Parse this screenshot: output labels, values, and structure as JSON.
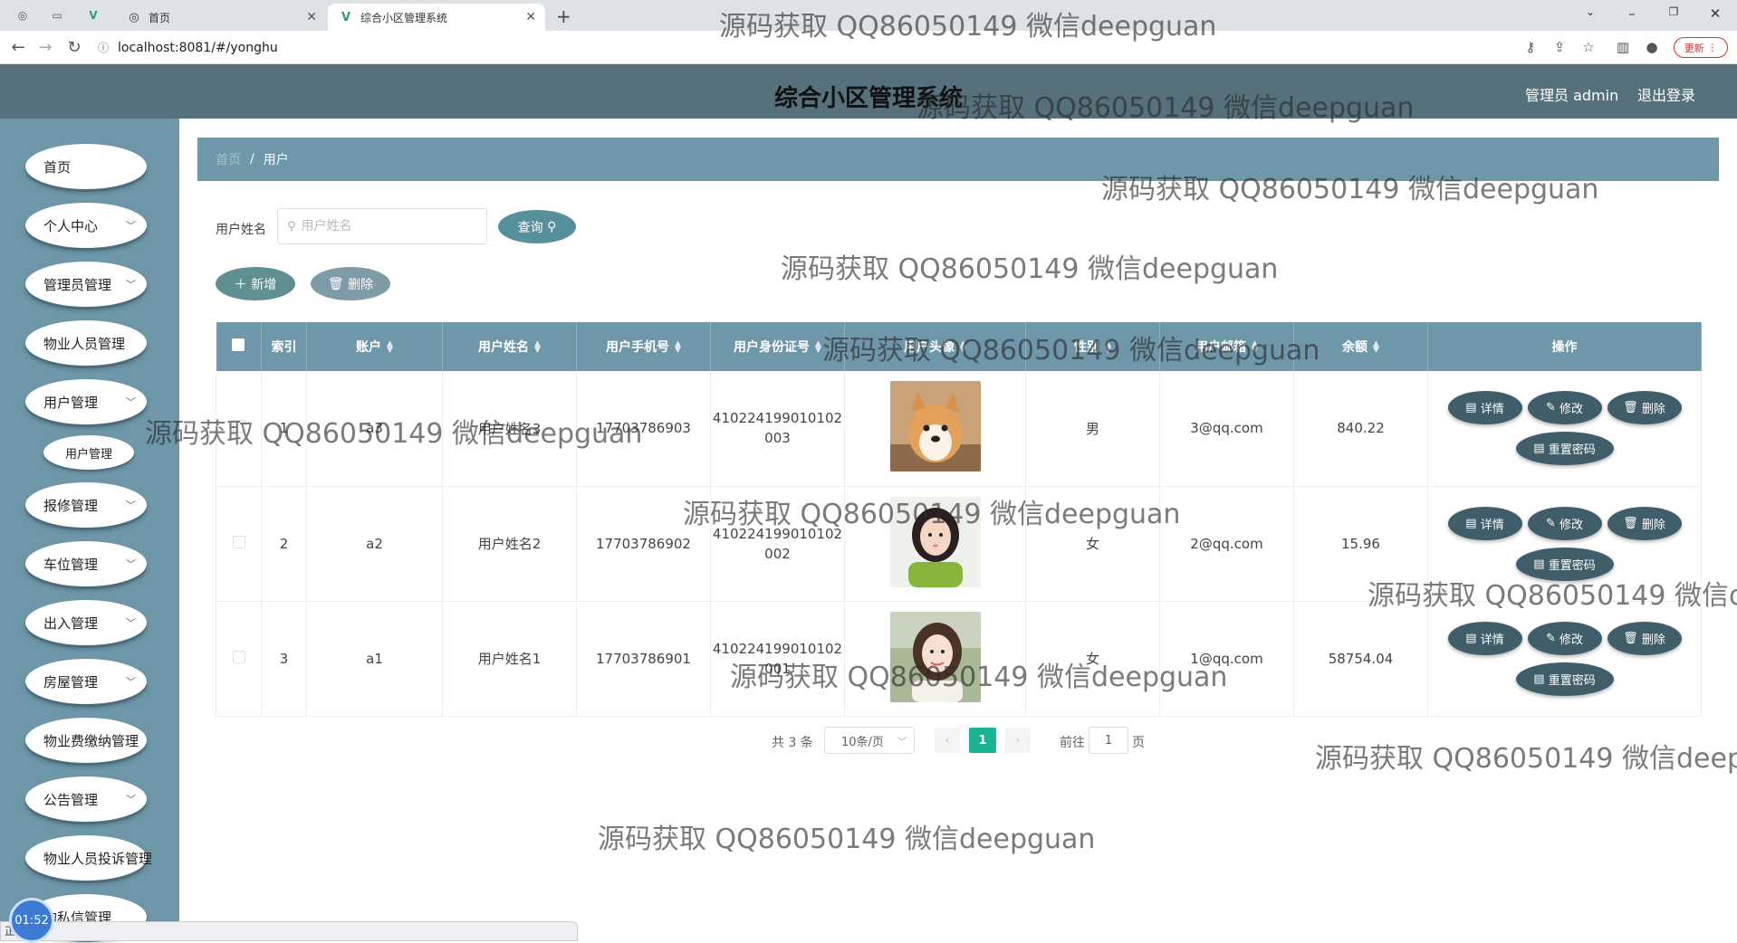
{
  "browser": {
    "tabs": [
      {
        "label": "首页",
        "icon": "globe-icon"
      },
      {
        "label": "综合小区管理系统",
        "icon": "vue-icon"
      }
    ],
    "url": "localhost:8081/#/yonghu",
    "update_label": "更新"
  },
  "header": {
    "title": "综合小区管理系统",
    "admin_label": "管理员 admin",
    "logout_label": "退出登录"
  },
  "sidebar": {
    "items": [
      {
        "label": "首页",
        "expandable": false
      },
      {
        "label": "个人中心",
        "expandable": true
      },
      {
        "label": "管理员管理",
        "expandable": true
      },
      {
        "label": "物业人员管理",
        "expandable": false
      },
      {
        "label": "用户管理",
        "expandable": true
      },
      {
        "label": "报修管理",
        "expandable": true
      },
      {
        "label": "车位管理",
        "expandable": true
      },
      {
        "label": "出入管理",
        "expandable": true
      },
      {
        "label": "房屋管理",
        "expandable": true
      },
      {
        "label": "物业费缴纳管理",
        "expandable": false
      },
      {
        "label": "公告管理",
        "expandable": true
      },
      {
        "label": "物业人员投诉管理",
        "expandable": false
      },
      {
        "label": "的私信管理",
        "expandable": false
      }
    ],
    "submenu": {
      "label": "用户管理"
    }
  },
  "breadcrumb": {
    "home": "首页",
    "current": "用户"
  },
  "search": {
    "label": "用户姓名",
    "placeholder": "用户姓名",
    "value": "",
    "query_label": "查询"
  },
  "actions": {
    "add_label": "新增",
    "delete_label": "删除"
  },
  "table": {
    "columns": [
      "索引",
      "账户",
      "用户姓名",
      "用户手机号",
      "用户身份证号",
      "用户头像",
      "性别",
      "用户邮箱",
      "余额",
      "操作"
    ],
    "rows": [
      {
        "index": "1",
        "account": "a3",
        "name": "用户姓名3",
        "phone": "17703786903",
        "id_card": [
          "410224199010102",
          "003"
        ],
        "avatar": "shiba-dog-photo",
        "gender": "男",
        "email": "3@qq.com",
        "balance": "840.22"
      },
      {
        "index": "2",
        "account": "a2",
        "name": "用户姓名2",
        "phone": "17703786902",
        "id_card": [
          "410224199010102",
          "002"
        ],
        "avatar": "girl-green-sweater-photo",
        "gender": "女",
        "email": "2@qq.com",
        "balance": "15.96"
      },
      {
        "index": "3",
        "account": "a1",
        "name": "用户姓名1",
        "phone": "17703786901",
        "id_card": [
          "410224199010102",
          "001"
        ],
        "avatar": "girl-outdoor-photo",
        "gender": "女",
        "email": "1@qq.com",
        "balance": "58754.04"
      }
    ],
    "row_actions": {
      "detail": "详情",
      "edit": "修改",
      "delete": "删除",
      "reset": "重置密码"
    }
  },
  "pagination": {
    "total": "共 3 条",
    "page_size": "10条/页",
    "current_page": "1",
    "goto_label": "前往",
    "goto_value": "1",
    "goto_suffix": "页"
  },
  "status": {
    "clock": "01:52",
    "text": "正..."
  },
  "watermark": "源码获取 QQ86050149 微信deepguan",
  "colors": {
    "header": "#56707c",
    "sidebar": "#6e98a9",
    "op_button": "#3f5e6a",
    "page_active": "#1ab394"
  }
}
